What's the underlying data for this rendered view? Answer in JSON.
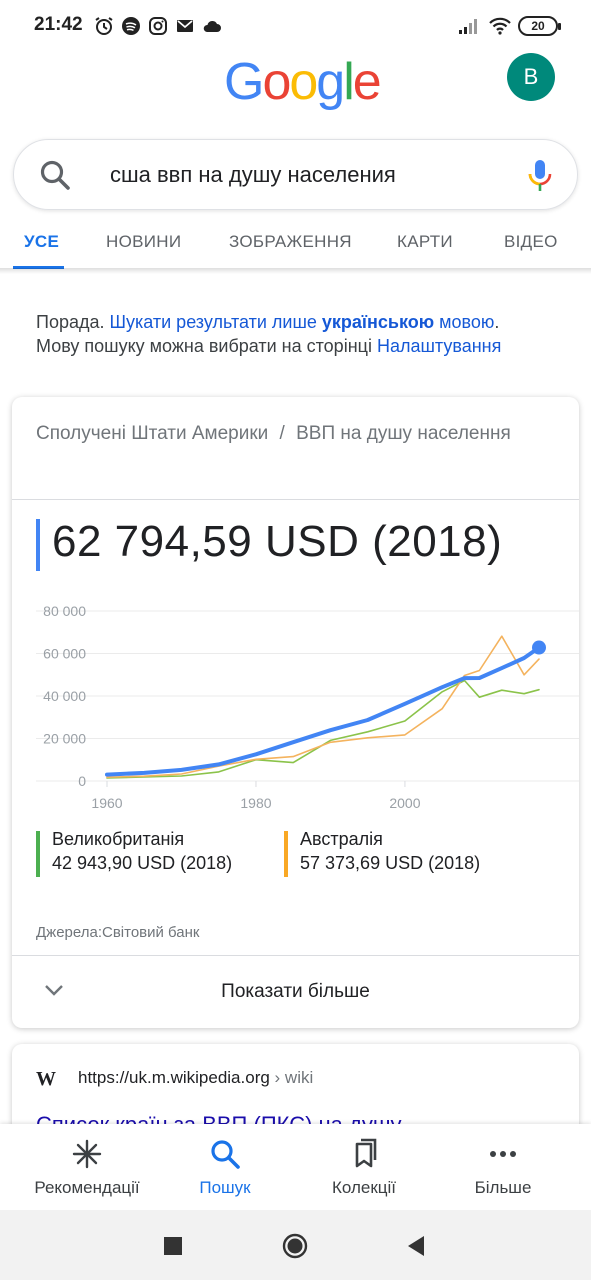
{
  "status_bar": {
    "time": "21:42",
    "battery": "20",
    "icons": [
      "alarm-icon",
      "spotify-icon",
      "instagram-icon",
      "gmail-icon",
      "cloud-icon",
      "signal-icon",
      "wifi-icon"
    ]
  },
  "header": {
    "logo_letters": [
      "G",
      "o",
      "o",
      "g",
      "l",
      "e"
    ],
    "logo_colors": [
      "#4285F4",
      "#EA4335",
      "#FBBC05",
      "#4285F4",
      "#34A853",
      "#EA4335"
    ],
    "avatar_letter": "B",
    "avatar_color": "#00897b"
  },
  "search": {
    "query": "сша ввп на душу населения"
  },
  "tabs": [
    {
      "label": "УСЕ",
      "active": true
    },
    {
      "label": "НОВИНИ",
      "active": false
    },
    {
      "label": "ЗОБРАЖЕННЯ",
      "active": false
    },
    {
      "label": "КАРТИ",
      "active": false
    },
    {
      "label": "ВІДЕО",
      "active": false
    }
  ],
  "tip": {
    "prefix": "Порада. ",
    "link_start": "Шукати результати лише ",
    "link_bold": "українською",
    "link_end": " мовою",
    "dot": ".",
    "line2": "Мову пошуку можна вибрати на сторінці ",
    "settings_link": "Налаштування"
  },
  "card": {
    "breadcrumb": "Сполучені Штати Америки",
    "separator": "/",
    "metric": "ВВП на душу населення",
    "value": "62 794,59 USD (2018)",
    "source": "Джерела:Світовий банк",
    "show_more": "Показати більше"
  },
  "chart_data": {
    "type": "line",
    "x": [
      1960,
      1965,
      1970,
      1975,
      1980,
      1985,
      1990,
      1995,
      2000,
      2005,
      2008,
      2010,
      2013,
      2016,
      2018
    ],
    "series": [
      {
        "name": "Сполучені Штати Америки",
        "color": "#4285f4",
        "values": [
          3007,
          3828,
          5234,
          7802,
          12575,
          18237,
          23889,
          28691,
          36335,
          44124,
          48402,
          48467,
          53107,
          57904,
          62795
        ]
      },
      {
        "name": "Великобританія",
        "color": "#8bc34a",
        "values": [
          1398,
          1874,
          2348,
          4299,
          10032,
          8652,
          19095,
          23169,
          28223,
          41987,
          47287,
          39436,
          42724,
          41064,
          42944
        ]
      },
      {
        "name": "Австралія",
        "color": "#f4b35e",
        "values": [
          1807,
          2277,
          3305,
          7005,
          10194,
          11499,
          18211,
          20319,
          21679,
          34016,
          49664,
          52022,
          68150,
          49971,
          57374
        ]
      }
    ],
    "y_ticks": [
      "80 000",
      "60 000",
      "40 000",
      "20 000",
      "0"
    ],
    "x_ticks": [
      "1960",
      "1980",
      "2000"
    ],
    "ylim": [
      0,
      80000
    ],
    "xlim": [
      1960,
      2018
    ]
  },
  "legend": [
    {
      "name": "Великобританія",
      "value": "42 943,90 USD (2018)",
      "color": "#4caf50"
    },
    {
      "name": "Австралія",
      "value": "57 373,69 USD (2018)",
      "color": "#f9a825"
    }
  ],
  "result": {
    "url": "https://uk.m.wikipedia.org",
    "crumb": " › wiki",
    "title": "Список країн за ВВП (ПКС) на душу"
  },
  "bottom_nav": [
    {
      "label": "Рекомендації",
      "icon": "asterisk-icon",
      "active": false
    },
    {
      "label": "Пошук",
      "icon": "search-icon",
      "active": true
    },
    {
      "label": "Колекції",
      "icon": "collections-icon",
      "active": false
    },
    {
      "label": "Більше",
      "icon": "more-icon",
      "active": false
    }
  ]
}
